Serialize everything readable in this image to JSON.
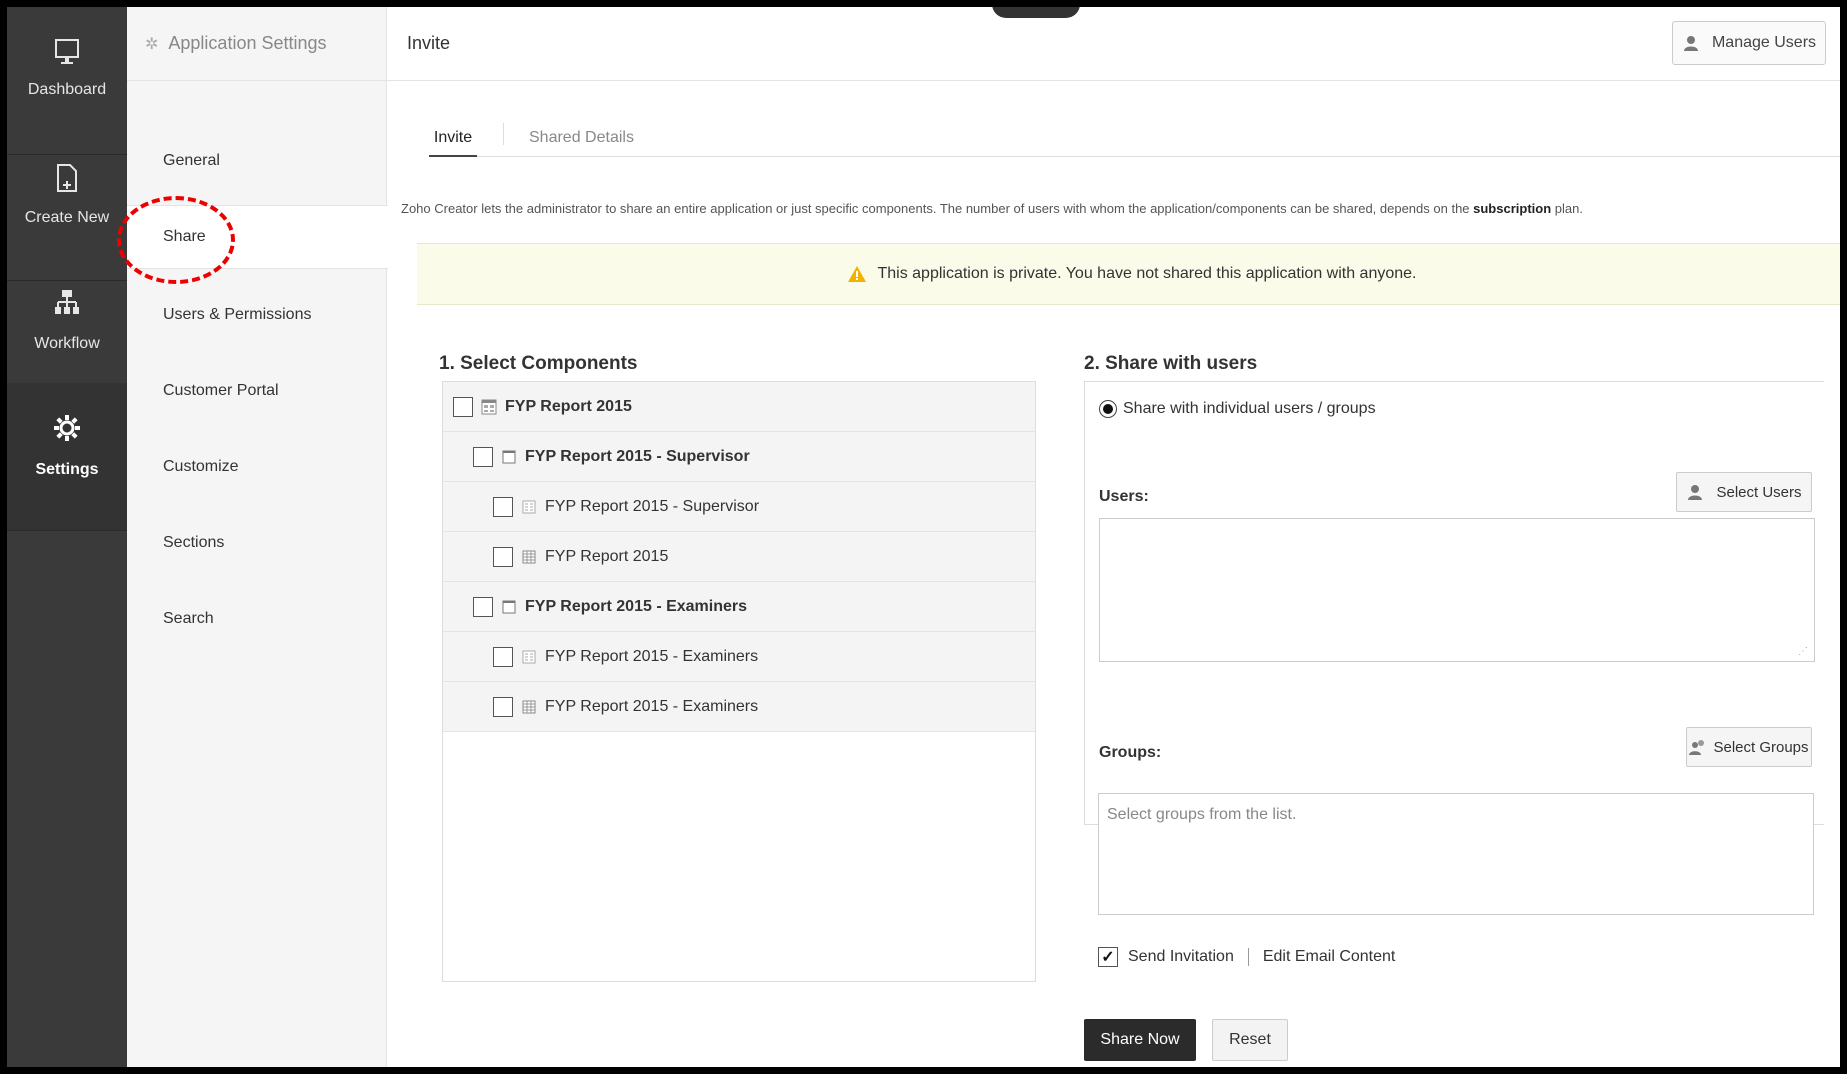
{
  "rail": {
    "items": [
      {
        "label": "Dashboard",
        "icon": "monitor-icon"
      },
      {
        "label": "Create New",
        "icon": "new-document-icon"
      },
      {
        "label": "Workflow",
        "icon": "workflow-icon"
      },
      {
        "label": "Settings",
        "icon": "gear-icon",
        "active": true
      }
    ]
  },
  "side": {
    "header": "Application Settings",
    "items": [
      {
        "label": "General"
      },
      {
        "label": "Share",
        "active": true
      },
      {
        "label": "Users & Permissions"
      },
      {
        "label": "Customer Portal"
      },
      {
        "label": "Customize"
      },
      {
        "label": "Sections"
      },
      {
        "label": "Search"
      }
    ]
  },
  "topbar": {
    "title": "Invite",
    "manage_users": "Manage Users"
  },
  "tabs": {
    "invite": "Invite",
    "shared_details": "Shared Details"
  },
  "intro": {
    "before": "Zoho Creator lets the administrator to share an entire application or just specific components. The number of users with whom the application/components can be shared, depends on the ",
    "bold": "subscription",
    "after": " plan."
  },
  "notice": "This application is private. You have not shared this application with anyone.",
  "select_components": {
    "title": "1. Select Components",
    "rows": [
      {
        "label": "FYP Report 2015",
        "level": 0,
        "bold": true,
        "icon": "application-icon"
      },
      {
        "label": "FYP Report 2015 - Supervisor",
        "level": 1,
        "bold": true,
        "icon": "section-icon"
      },
      {
        "label": "FYP Report 2015 - Supervisor",
        "level": 2,
        "bold": false,
        "icon": "form-icon"
      },
      {
        "label": "FYP Report 2015",
        "level": 2,
        "bold": false,
        "icon": "report-icon"
      },
      {
        "label": "FYP Report 2015 - Examiners",
        "level": 1,
        "bold": true,
        "icon": "section-icon"
      },
      {
        "label": "FYP Report 2015 - Examiners",
        "level": 2,
        "bold": false,
        "icon": "form-icon"
      },
      {
        "label": "FYP Report 2015 - Examiners",
        "level": 2,
        "bold": false,
        "icon": "report-icon"
      }
    ]
  },
  "share_with_users": {
    "title": "2. Share with users",
    "radio_label": "Share with individual users / groups",
    "users_label": "Users:",
    "select_users": "Select Users",
    "groups_label": "Groups:",
    "select_groups": "Select Groups",
    "groups_placeholder": "Select groups from the list.",
    "send_invitation": "Send Invitation",
    "send_invitation_checked": true,
    "edit_email": "Edit Email Content"
  },
  "actions": {
    "share_now": "Share Now",
    "reset": "Reset"
  }
}
